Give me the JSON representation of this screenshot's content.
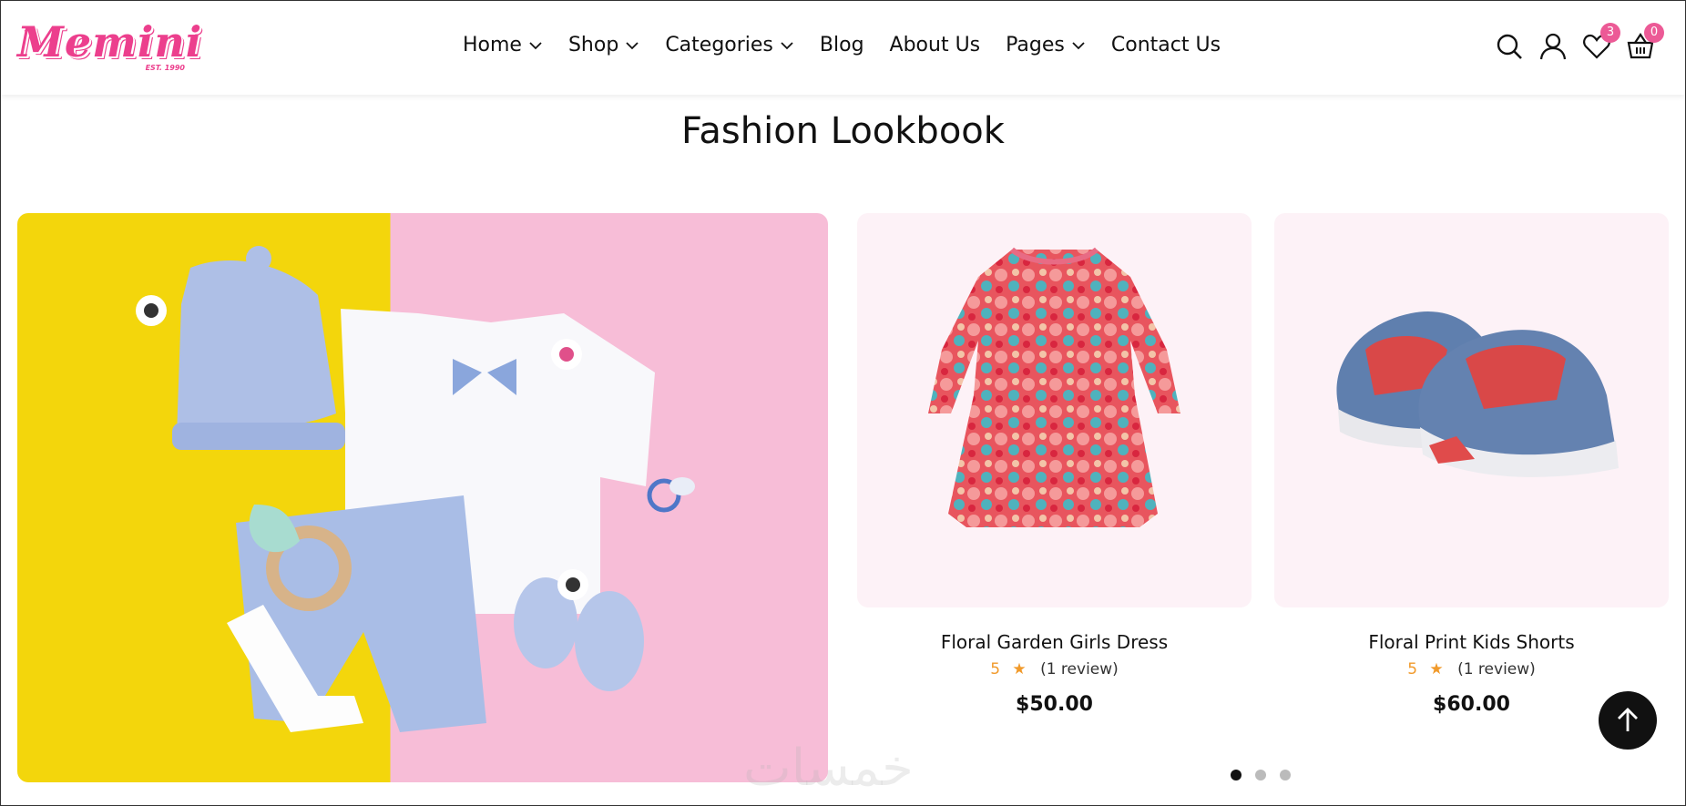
{
  "brand": {
    "logo_text": "Memini",
    "logo_est": "EST. 1990",
    "accent": "#ec3f8d"
  },
  "nav": {
    "items": [
      {
        "label": "Home",
        "dropdown": true
      },
      {
        "label": "Shop",
        "dropdown": true
      },
      {
        "label": "Categories",
        "dropdown": true
      },
      {
        "label": "Blog",
        "dropdown": false
      },
      {
        "label": "About Us",
        "dropdown": false
      },
      {
        "label": "Pages",
        "dropdown": true
      },
      {
        "label": "Contact Us",
        "dropdown": false
      }
    ]
  },
  "header_icons": {
    "search": "search-icon",
    "account": "user-icon",
    "wishlist": {
      "icon": "heart-icon",
      "count": "3"
    },
    "cart": {
      "icon": "basket-icon",
      "count": "0"
    }
  },
  "section": {
    "title": "Fashion Lookbook"
  },
  "products": [
    {
      "name": "Floral Garden Girls Dress",
      "rating": "5",
      "reviews": "(1 review)",
      "price": "$50.00"
    },
    {
      "name": "Floral Print Kids Shorts",
      "rating": "5",
      "reviews": "(1 review)",
      "price": "$60.00"
    }
  ],
  "carousel": {
    "pages": 3,
    "active": 1
  },
  "watermark": "خمسات"
}
